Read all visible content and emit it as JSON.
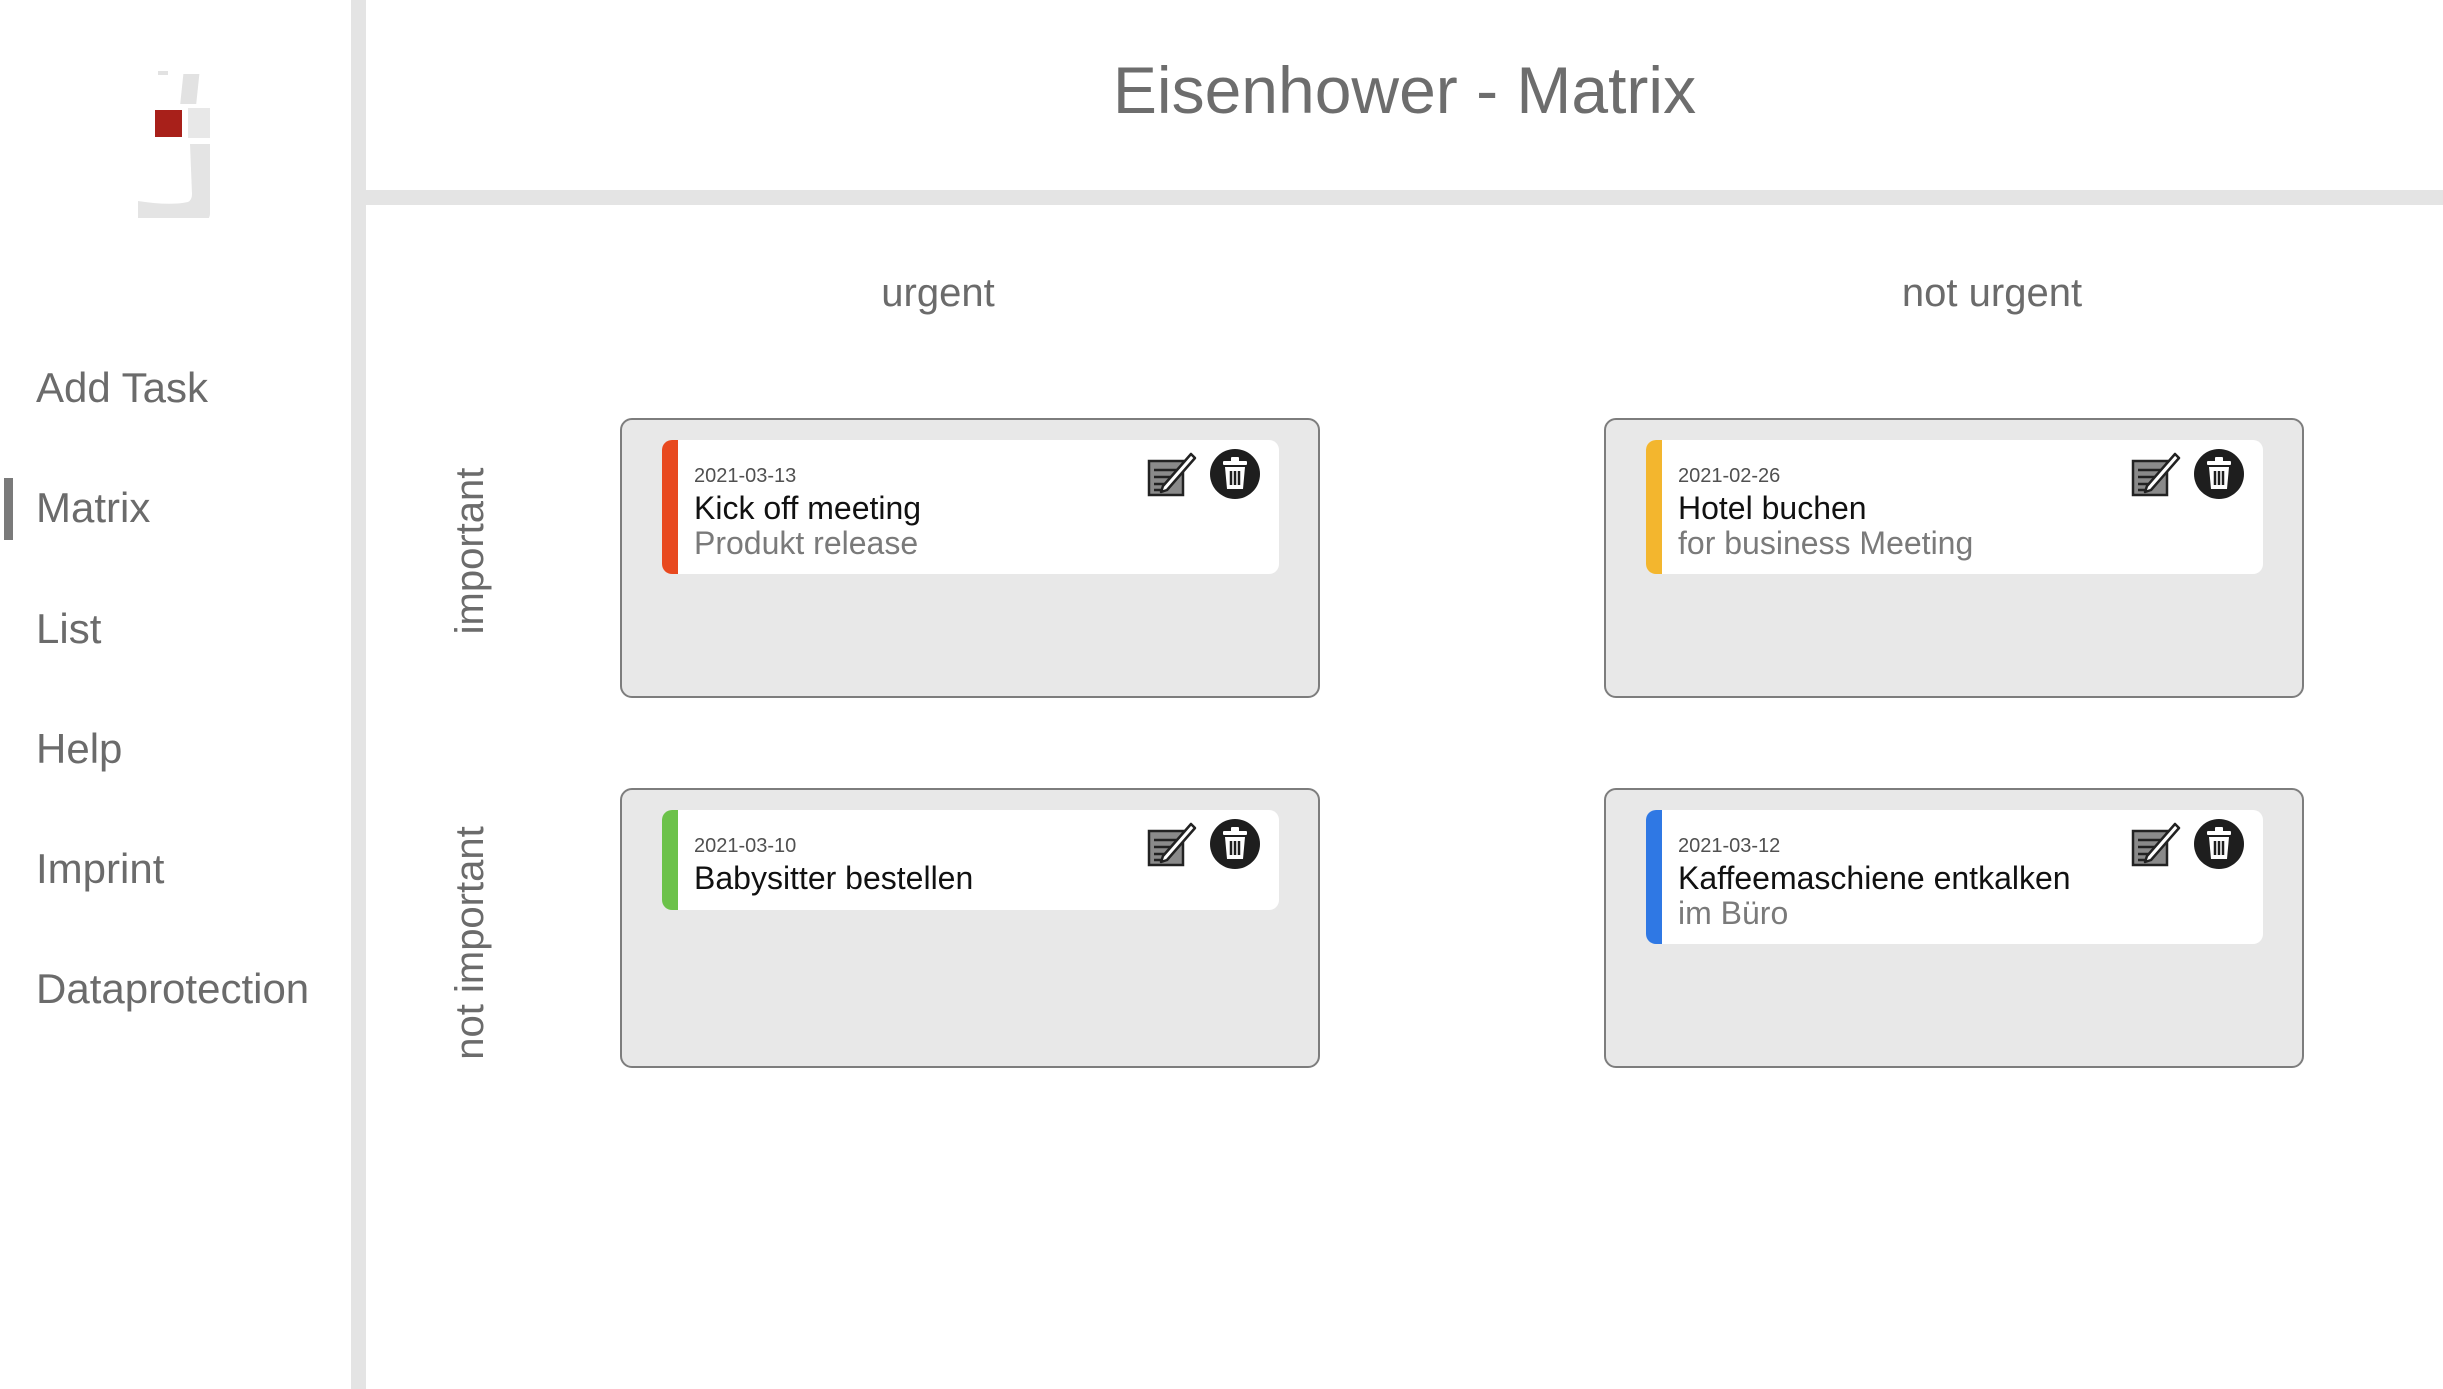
{
  "app": {
    "logo_icon": "j-logo-icon"
  },
  "sidebar": {
    "items": [
      {
        "label": "Add Task"
      },
      {
        "label": "Matrix",
        "active": true
      },
      {
        "label": "List"
      },
      {
        "label": "Help"
      },
      {
        "label": "Imprint"
      },
      {
        "label": "Dataprotection"
      }
    ]
  },
  "header": {
    "title": "Eisenhower - Matrix"
  },
  "matrix": {
    "columns": [
      "urgent",
      "not urgent"
    ],
    "rows": [
      "important",
      "not important"
    ],
    "quadrants": [
      {
        "tasks": [
          {
            "date": "2021-03-13",
            "title": "Kick off meeting",
            "description": "Produkt release",
            "color": "#e8491f"
          }
        ]
      },
      {
        "tasks": [
          {
            "date": "2021-02-26",
            "title": "Hotel buchen",
            "description": "for business Meeting",
            "color": "#f3b62e"
          }
        ]
      },
      {
        "tasks": [
          {
            "date": "2021-03-10",
            "title": "Babysitter bestellen",
            "description": "",
            "color": "#6cc24a"
          }
        ]
      },
      {
        "tasks": [
          {
            "date": "2021-03-12",
            "title": "Kaffeemaschiene entkalken",
            "description": "im Büro",
            "color": "#2f78e4"
          }
        ]
      }
    ]
  },
  "icons": {
    "edit": "edit-icon",
    "delete": "trash-icon"
  },
  "colors": {
    "accent_gray": "#6d6d6d",
    "quadrant_bg": "#e8e8e8",
    "logo_red": "#a8201a"
  }
}
